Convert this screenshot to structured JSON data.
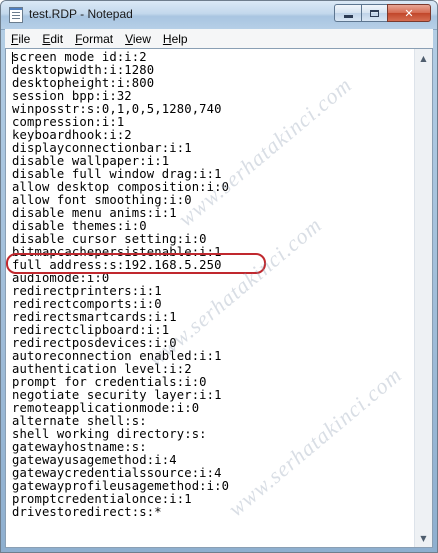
{
  "window": {
    "title": "test.RDP - Notepad",
    "icon": "notepad-icon",
    "controls": [
      "minimize-icon",
      "maximize-icon",
      "close-icon"
    ]
  },
  "menu": {
    "file": {
      "mnemonic": "F",
      "rest": "ile"
    },
    "edit": {
      "mnemonic": "E",
      "rest": "dit"
    },
    "format": {
      "mnemonic": "F",
      "rest": "ormat"
    },
    "view": {
      "mnemonic": "V",
      "rest": "iew"
    },
    "help": {
      "mnemonic": "H",
      "rest": "elp"
    }
  },
  "document": {
    "lines": [
      "screen mode id:i:2",
      "desktopwidth:i:1280",
      "desktopheight:i:800",
      "session bpp:i:32",
      "winposstr:s:0,1,0,5,1280,740",
      "compression:i:1",
      "keyboardhook:i:2",
      "displayconnectionbar:i:1",
      "disable wallpaper:i:1",
      "disable full window drag:i:1",
      "allow desktop composition:i:0",
      "allow font smoothing:i:0",
      "disable menu anims:i:1",
      "disable themes:i:0",
      "disable cursor setting:i:0",
      "bitmapcachepersistenable:i:1",
      "full address:s:192.168.5.250",
      "audiomode:i:0",
      "redirectprinters:i:1",
      "redirectcomports:i:0",
      "redirectsmartcards:i:1",
      "redirectclipboard:i:1",
      "redirectposdevices:i:0",
      "autoreconnection enabled:i:1",
      "authentication level:i:2",
      "prompt for credentials:i:0",
      "negotiate security layer:i:1",
      "remoteapplicationmode:i:0",
      "alternate shell:s:",
      "shell working directory:s:",
      "gatewayhostname:s:",
      "gatewayusagemethod:i:4",
      "gatewaycredentialssource:i:4",
      "gatewayprofileusagemethod:i:0",
      "promptcredentialonce:i:1",
      "drivestoredirect:s:*"
    ],
    "highlighted_line": "full address:s:192.168.5.250"
  },
  "watermark": "www.serhatakinci.com",
  "colors": {
    "highlight": "#c0282e"
  }
}
